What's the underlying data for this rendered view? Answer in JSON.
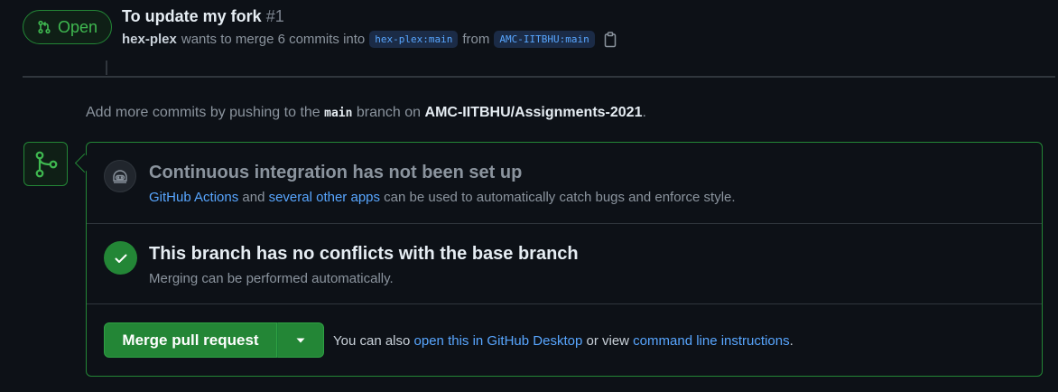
{
  "header": {
    "state_label": "Open",
    "title": "To update my fork",
    "number": "#1",
    "author": "hex-plex",
    "merge_text": "wants to merge 6 commits into",
    "base_branch": "hex-plex:main",
    "from_text": "from",
    "head_branch": "AMC-IITBHU:main"
  },
  "hint": {
    "prefix": "Add more commits by pushing to the",
    "branch": "main",
    "middle": "branch on",
    "repo": "AMC-IITBHU/Assignments-2021",
    "suffix": "."
  },
  "ci": {
    "heading": "Continuous integration has not been set up",
    "link1": "GitHub Actions",
    "text1": "and",
    "link2": "several other apps",
    "text2": "can be used to automatically catch bugs and enforce style."
  },
  "conflicts": {
    "heading": "This branch has no conflicts with the base branch",
    "desc": "Merging can be performed automatically."
  },
  "merge": {
    "button_label": "Merge pull request",
    "note_prefix": "You can also",
    "link1": "open this in GitHub Desktop",
    "note_middle": "or view",
    "link2": "command line instructions",
    "note_suffix": "."
  },
  "colors": {
    "background": "#0d1117",
    "success": "#238636",
    "success_text": "#3fb950",
    "link": "#58a6ff",
    "border": "#30363d"
  },
  "icons": {
    "state": "git-pull-request-icon",
    "copy": "copy-icon",
    "merge": "git-merge-icon",
    "ci": "actions-bot-icon",
    "check": "check-icon",
    "dropdown": "triangle-down-icon"
  }
}
